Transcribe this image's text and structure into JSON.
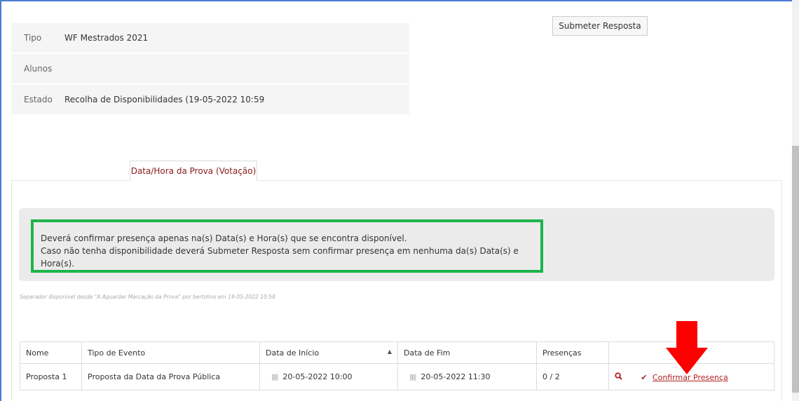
{
  "submit_label": "Submeter Resposta",
  "info": [
    {
      "label": "Tipo",
      "value": "WF Mestrados 2021"
    },
    {
      "label": "Alunos",
      "value": ""
    },
    {
      "label": "Estado",
      "value": "Recolha de Disponibilidades (19-05-2022 10:59"
    }
  ],
  "tab_label": "Data/Hora da Prova (Votação)",
  "notice": {
    "line1": "Deverá confirmar presença apenas na(s) Data(s) e Hora(s) que se encontra disponível.",
    "line2": "Caso não tenha disponibilidade deverá Submeter Resposta sem confirmar presença em nenhuma da(s) Data(s) e Hora(s)."
  },
  "separator_note": "Separador disponível desde \"A Aguardar Marcação da Prova\" por bertolino em 19-05-2022 10:58",
  "table": {
    "headers": [
      "Nome",
      "Tipo de Evento",
      "Data de Início",
      "Data de Fim",
      "Presenças",
      ""
    ],
    "rows": [
      {
        "nome": "Proposta 1",
        "tipo": "Proposta da Data da Prova Pública",
        "inicio": "20-05-2022 10:00",
        "fim": "20-05-2022 11:30",
        "presencas": "0 / 2",
        "action": "Confirmar Presença"
      }
    ]
  },
  "icons": {
    "calendar": "calendar-icon",
    "search": "search-icon",
    "check": "check-icon",
    "sort": "sort-asc-icon",
    "annotation": "red-arrow-down"
  },
  "colors": {
    "accent": "#b22222",
    "tab_text": "#8b1a1a",
    "highlight_border": "#1db44a",
    "frame_border": "#4a7bd0",
    "annotation_arrow": "#ff0000"
  }
}
